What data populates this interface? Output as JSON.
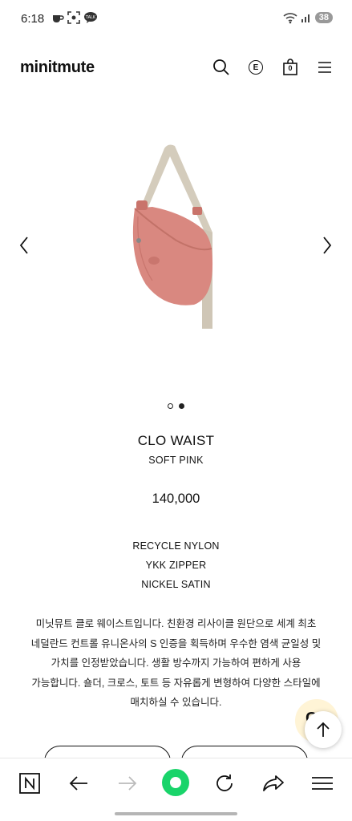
{
  "status_bar": {
    "time": "6:18",
    "battery": "38",
    "left_icons": [
      "coffee-icon",
      "scan-icon",
      "talk-icon"
    ],
    "right_icons": [
      "wifi-icon",
      "signal-icon",
      "battery-icon"
    ]
  },
  "header": {
    "logo": "minitmute",
    "language": "E",
    "cart_count": "0"
  },
  "carousel": {
    "total": 2,
    "active_index": 1
  },
  "product": {
    "name": "CLO WAIST",
    "color": "SOFT PINK",
    "price": "140,000",
    "specs": [
      "RECYCLE NYLON",
      "YKK ZIPPER",
      "NICKEL SATIN"
    ],
    "description": "미닛뮤트 클로 웨이스트입니다. 친환경 리사이클 원단으로 세계 최초 네덜란드 컨트롤 유니온사의 S 인증을 획득하며 우수한 염색 균일성 및 가치를 인정받았습니다. 생활 방수까지 가능하여 편하게 사용 가능합니다. 숄더, 크로스, 토트 등 자유롭게 변형하여 다양한 스타일에 매치하실 수 있습니다."
  },
  "chat": {
    "glyph": "C"
  },
  "colors": {
    "accent_green": "#19d46a",
    "bag_pink": "#d98880",
    "strap_beige": "#cfc6b6"
  }
}
